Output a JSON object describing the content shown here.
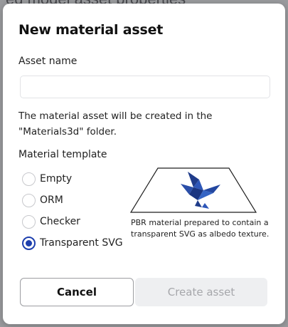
{
  "backdrop": {
    "text": "ed model asset properties"
  },
  "dialog": {
    "title": "New material asset",
    "asset_name_label": "Asset name",
    "asset_name_value": "",
    "info_line1": "The material asset will be created in the",
    "info_line2": "\"Materials3d\" folder.",
    "template_label": "Material template",
    "templates": [
      {
        "label": "Empty",
        "checked": false
      },
      {
        "label": "ORM",
        "checked": false
      },
      {
        "label": "Checker",
        "checked": false
      },
      {
        "label": "Transparent SVG",
        "checked": true
      }
    ],
    "preview_icon": "origami-bird-icon",
    "preview_description": "PBR material prepared to contain a transparent SVG as albedo texture.",
    "cancel_label": "Cancel",
    "create_label": "Create asset",
    "accent_color": "#1d3fae"
  }
}
